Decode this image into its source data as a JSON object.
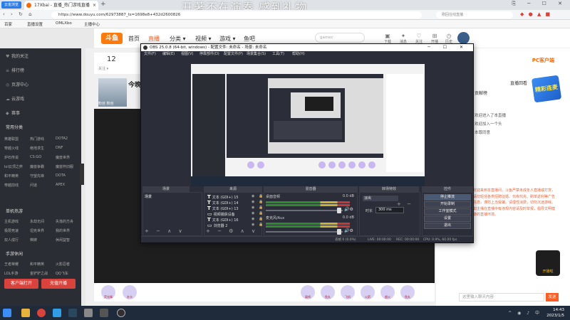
{
  "browser": {
    "logo": "云雀浏览",
    "tab_title": "17Xbai - 直播_热门游戏直播",
    "tab_close": "×",
    "new_tab": "+",
    "overlay_text": "开著不在演奏 感到礼物",
    "window_controls": "⎘ ─ ☐ ✕",
    "nav_buttons": "‹ › ↻ ⌂",
    "url": "https://www.douyu.com/62973887_ts=1698e8+432d2600826",
    "search_placeholder": "刚回在线直播",
    "extensions": "◆ ● ▲ ■"
  },
  "bookmarks": [
    "百家",
    "直播设置",
    "OMLXbo",
    "主播中心"
  ],
  "site": {
    "brand": "斗鱼",
    "nav": [
      "首页",
      "直播",
      "分类 ▾",
      "视频 ▾",
      "游戏 ▾",
      "鱼吧"
    ],
    "nav_active": 1,
    "search_placeholder": "gamec",
    "top_icons": [
      {
        "icon": "▣",
        "label": "下载"
      },
      {
        "icon": "✦",
        "label": "消息"
      },
      {
        "icon": "♡",
        "label": "关注"
      },
      {
        "icon": "⊞",
        "label": "开播"
      },
      {
        "icon": "◷",
        "label": "历史"
      }
    ]
  },
  "sidebar": {
    "items": [
      {
        "icon": "♥",
        "label": "我的关注"
      },
      {
        "icon": "≡",
        "label": "排行榜"
      },
      {
        "icon": "◎",
        "label": "页游中心"
      },
      {
        "icon": "☁",
        "label": "云游戏"
      },
      {
        "icon": "◆",
        "label": "赛事"
      }
    ],
    "section_common": "常用分类",
    "grid": [
      "英雄联盟",
      "热门游戏",
      "DOTA2",
      "穿越火线",
      "绝地求生",
      "DNF",
      "炉石传说",
      "CS:GO",
      "魔兽世界",
      "lol云顶之弈",
      "魔兽争霸",
      "魔兽怀旧服",
      "和平精英",
      "守望先锋",
      "DOTA",
      "穿越前线",
      "问道",
      "APEX"
    ],
    "section_mobile": "单机热游",
    "grid2": [
      "主机游戏",
      "永劫无间",
      "失落的方舟",
      "极限竞速",
      "坦克世界",
      "我的世界",
      "双人成行",
      "棋牌",
      "休闲益智"
    ],
    "section_phone": "手游休闲",
    "grid3": [
      "王者荣耀",
      "和平精英",
      "火影忍者",
      "LOL手游",
      "金铲铲之战",
      "QQ飞车"
    ],
    "btn_left": "客户端打开",
    "btn_right": "充值开播"
  },
  "room": {
    "follower_count": "12",
    "follower_label": "关注 ▾",
    "title": "今晚",
    "sub": "粉丝 粉丝"
  },
  "gifts": [
    "荧光棒",
    "办卡",
    "弱鸡",
    "鱼丸",
    "飞机",
    "火箭",
    "超火",
    "鱼丸"
  ],
  "right": {
    "pc_button": "PC客户端",
    "live_replay": "直播回看",
    "rank_label": "贡献榜",
    "notice": "欢迎来到本直播间，斗鱼严禁未成年人直播或打赏，请勿轻信各类招聘征婚、代练代充、刷单返利等广告信息，谨防上当受骗。请理性消费，切勿沉迷游戏。如主播在直播中有违规内容请及时举报，倡导文明健康的直播环境。",
    "feed": [
      "欢迎进入了本直播",
      "欢迎加入一个头",
      "本尊同意"
    ],
    "chat_placeholder": "这里输入聊天内容",
    "send": "发送",
    "badge": "精彩连麦",
    "mascot": "开播啦"
  },
  "obs": {
    "title": "OBS 25.0.8 (64-bit, windows) - 配置文件: 未命名 - 场景: 未命名",
    "window_controls": "─ ☐ ✕",
    "menu": [
      "文件(F)",
      "编辑(E)",
      "视图(V)",
      "停靠部件(D)",
      "配置文件(P)",
      "场景集合(S)",
      "工具(T)",
      "帮助(H)"
    ],
    "docks": {
      "scenes": "场景",
      "sources": "来源",
      "mixer": "混音器",
      "transitions": "转场特效",
      "controls": "控件"
    },
    "scene_item": "场景",
    "sources": [
      {
        "type": "T",
        "label": "文本 (GDI+) 15"
      },
      {
        "type": "T",
        "label": "文本 (GDI+) 14"
      },
      {
        "type": "T",
        "label": "文本 (GDI+) 13"
      },
      {
        "type": "▭",
        "label": "视频捕获设备"
      },
      {
        "type": "T",
        "label": "文本 (GDI+) 16"
      },
      {
        "type": "▭",
        "label": "浏览器 2"
      }
    ],
    "mixer": [
      {
        "name": "桌面音频",
        "db": "0.0 dB"
      },
      {
        "name": "麦克风/Aux",
        "db": "0.0 dB"
      }
    ],
    "transition_type": "淡出",
    "duration_label": "时长",
    "duration_value": "300 ms",
    "controls": [
      "停止推流",
      "开始录制",
      "工作室模式",
      "设置",
      "退出"
    ],
    "status": {
      "frames": "丢帧 0 (0.0%)",
      "live": "LIVE: 00:00:00",
      "rec": "REC: 00:00:00",
      "cpu": "CPU: 0.9%, 60.00 fps"
    }
  },
  "taskbar": {
    "time": "14:43",
    "date": "2023/1/5",
    "tray": "^ ◉ ♪ 中"
  }
}
